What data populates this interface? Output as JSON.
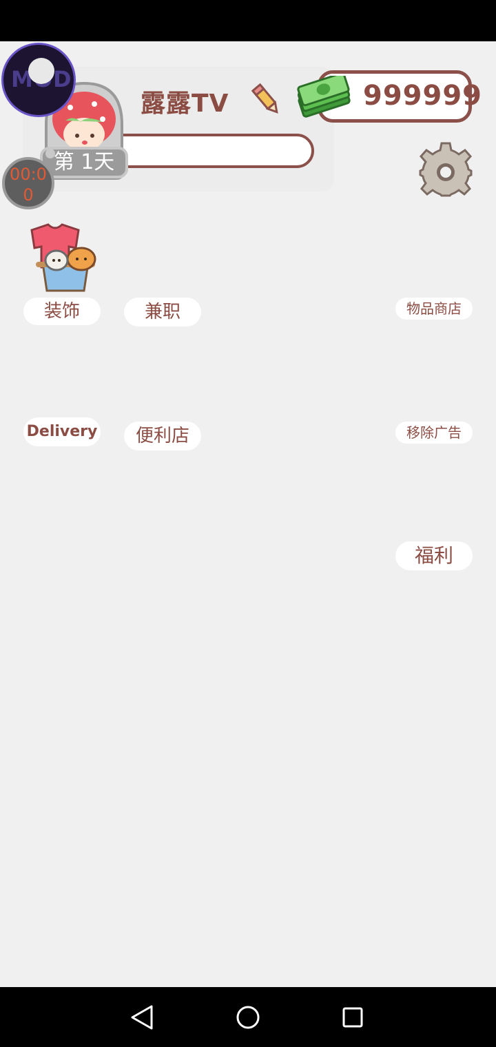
{
  "header": {
    "username": "露露TV",
    "money": "999999",
    "day_label": "第 1天",
    "progress": 0
  },
  "overlays": {
    "mod_label": "MOD",
    "timer": "00:0 0"
  },
  "menu": {
    "decorate": "装饰",
    "part_time": "兼职",
    "item_shop": "物品商店",
    "delivery": "Delivery",
    "convenience_store": "便利店",
    "remove_ads": "移除广告",
    "welfare": "福利"
  },
  "icons": {
    "pencil": "pencil-icon",
    "cash": "cash-icon",
    "settings": "gear-icon",
    "decorate": "clothes-basket-icon",
    "back": "back-triangle-icon",
    "home": "home-circle-icon",
    "recents": "recents-square-icon"
  },
  "colors": {
    "accent_brown": "#8b4c43",
    "background": "#f1f0f0",
    "timer_text": "#e05a35"
  }
}
